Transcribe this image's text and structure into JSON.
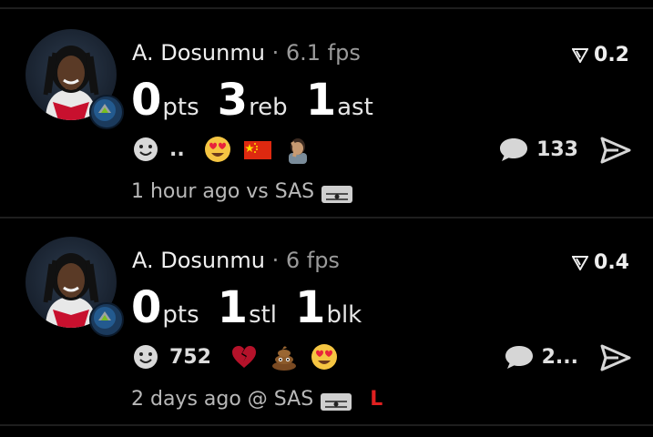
{
  "posts": [
    {
      "player_name": "A. Dosunmu",
      "fps": "6.1 fps",
      "vote_score": "0.2",
      "stats": [
        {
          "value": "0",
          "label": "pts"
        },
        {
          "value": "3",
          "label": "reb"
        },
        {
          "value": "1",
          "label": "ast"
        }
      ],
      "reactions": [
        {
          "icon": "smile-emoji",
          "count": ".."
        },
        {
          "icon": "heart-eyes-emoji",
          "count": ""
        },
        {
          "icon": "china-flag-emoji",
          "count": ""
        },
        {
          "icon": "facepalm-person-emoji",
          "count": ""
        }
      ],
      "comment_count": "133",
      "time": "1 hour ago vs SAS",
      "result": ""
    },
    {
      "player_name": "A. Dosunmu",
      "fps": "6 fps",
      "vote_score": "0.4",
      "stats": [
        {
          "value": "0",
          "label": "pts"
        },
        {
          "value": "1",
          "label": "stl"
        },
        {
          "value": "1",
          "label": "blk"
        }
      ],
      "reactions": [
        {
          "icon": "smile-emoji",
          "count": "752"
        },
        {
          "icon": "broken-heart-emoji",
          "count": ""
        },
        {
          "icon": "poop-emoji",
          "count": ""
        },
        {
          "icon": "heart-eyes-emoji",
          "count": ""
        }
      ],
      "comment_count": "2...",
      "time": "2 days ago @ SAS",
      "result": "L"
    }
  ],
  "colors": {
    "background": "#000000",
    "divider": "#1e1e1e",
    "loss_red": "#e02020",
    "emoji_yellow": "#f5c542"
  }
}
